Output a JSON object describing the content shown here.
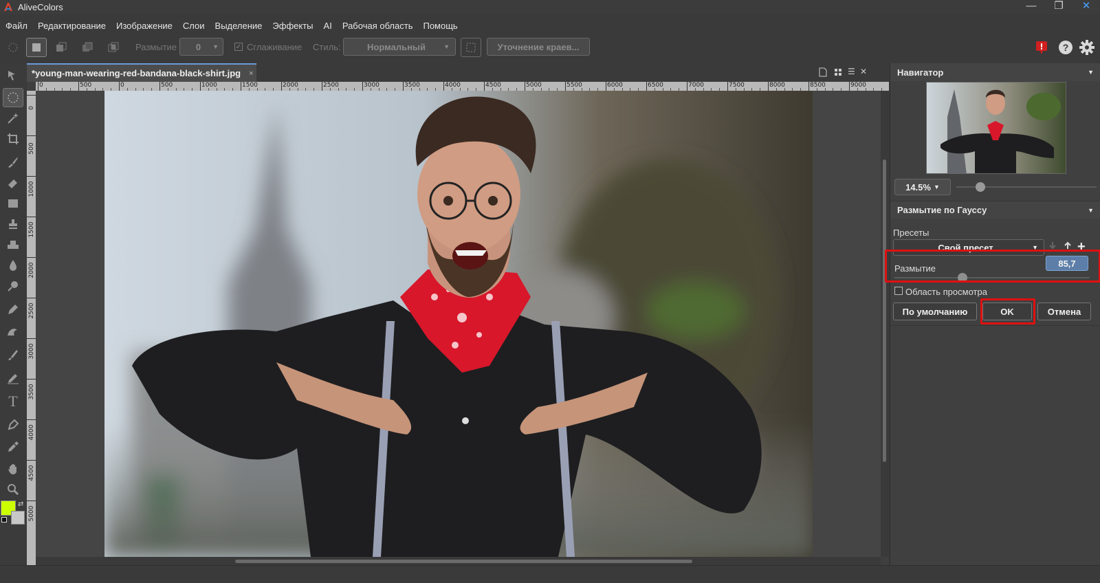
{
  "app": {
    "title": "AliveColors",
    "controls": {
      "minimize": "—",
      "maximize": "❐",
      "close": "✕"
    }
  },
  "menu": [
    "Файл",
    "Редактирование",
    "Изображение",
    "Слои",
    "Выделение",
    "Эффекты",
    "AI",
    "Рабочая область",
    "Помощь"
  ],
  "options": {
    "blur_label": "Размытие",
    "blur_value": "0",
    "antialias_label": "Сглаживание",
    "style_label": "Стиль:",
    "style_value": "Нормальный",
    "refine_label": "Уточнение краев..."
  },
  "document": {
    "tab_title": "*young-man-wearing-red-bandana-black-shirt.jpg",
    "tab_close": "×",
    "ruler_h": [
      "0",
      "500",
      "0",
      "500",
      "1000",
      "1500",
      "2000",
      "2500",
      "3000",
      "3500",
      "4000",
      "4500",
      "5000",
      "5500",
      "6000",
      "6500",
      "7000",
      "7500",
      "8000",
      "8500",
      "9000"
    ],
    "ruler_v": [
      "0",
      "500",
      "1000",
      "1500",
      "2000",
      "2500",
      "3000",
      "3500",
      "4000",
      "4500",
      "5000"
    ]
  },
  "navigator": {
    "title": "Навигатор",
    "zoom": "14.5%"
  },
  "gaussian": {
    "title": "Размытие по Гауссу",
    "presets_label": "Пресеты",
    "preset_value": "Свой пресет",
    "blur_label": "Размытие",
    "blur_value": "85,7",
    "blur_fraction": 0.35,
    "preview_label": "Область просмотра",
    "default_button": "По умолчанию",
    "ok_button": "OK",
    "cancel_button": "Отмена"
  },
  "colors": {
    "foreground": "#ccff00",
    "background": "#c8c8c8",
    "highlight": "#e01010"
  }
}
